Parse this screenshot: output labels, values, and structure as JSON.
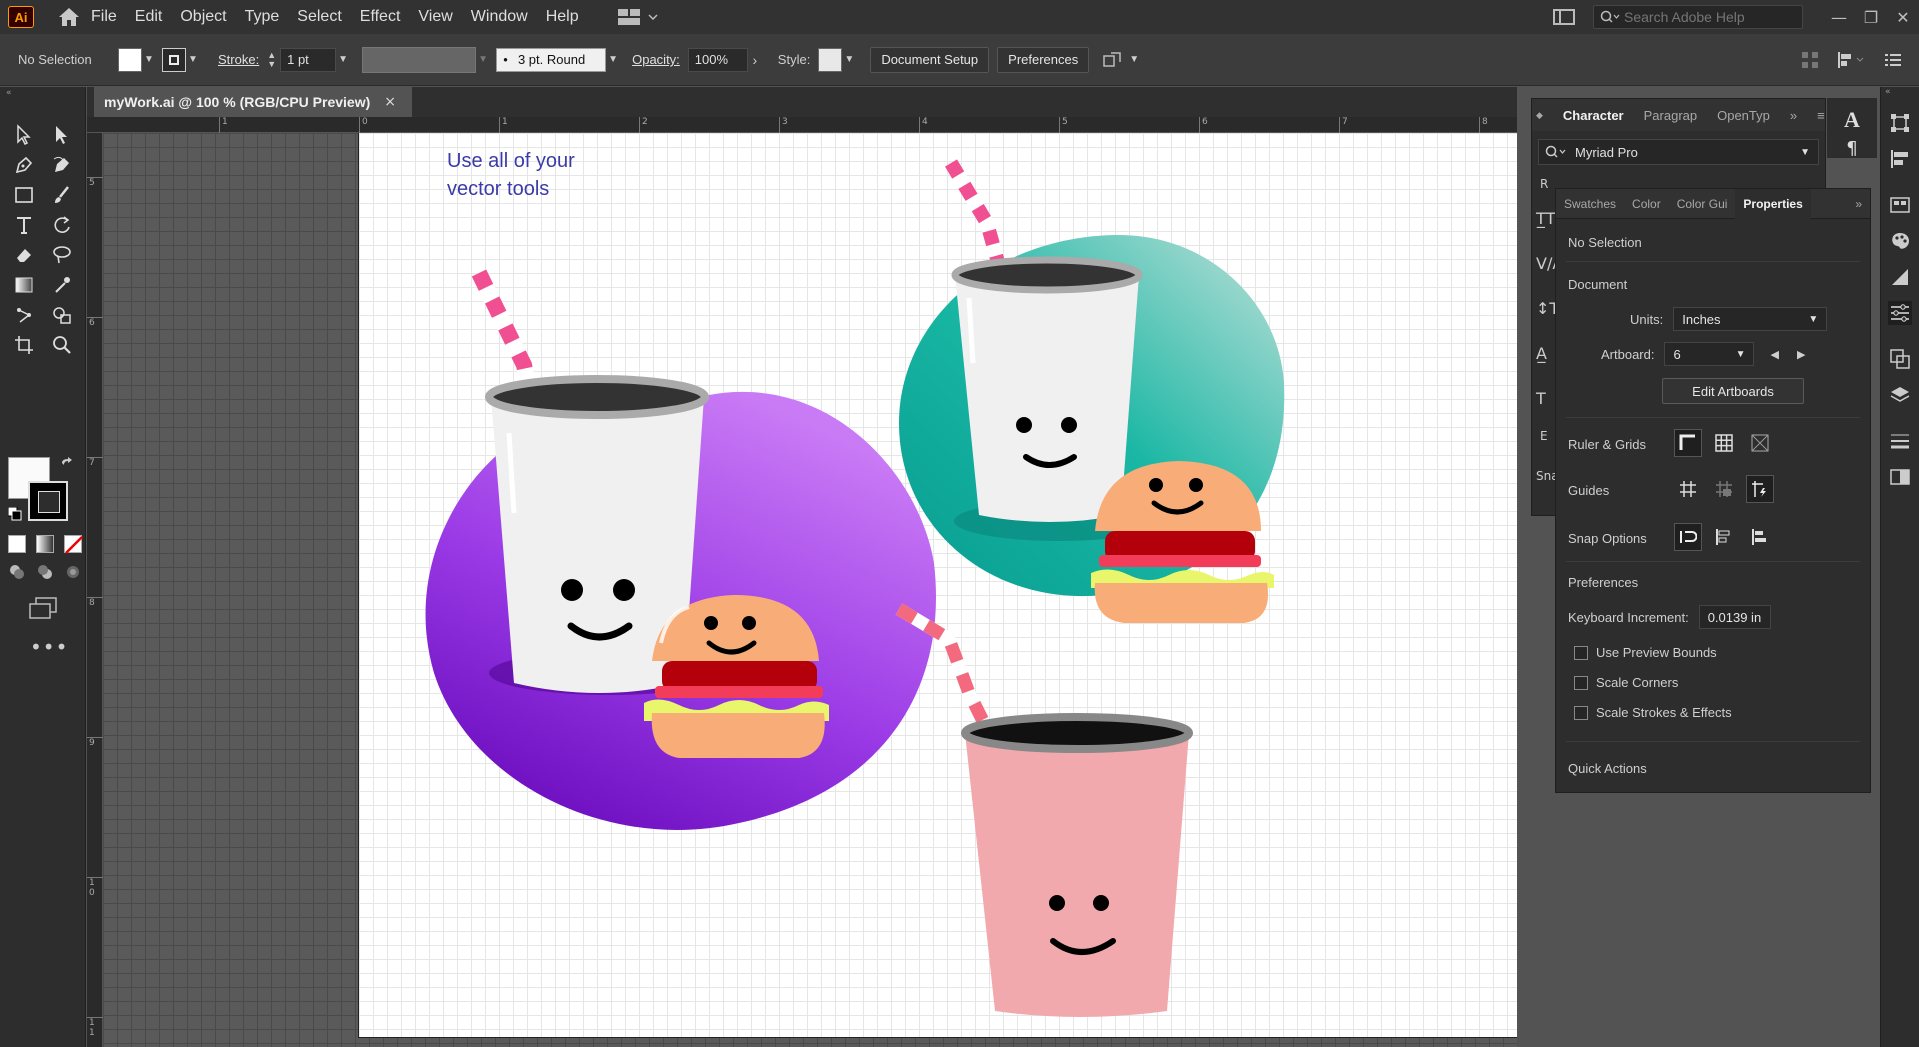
{
  "app": {
    "logo_text": "Ai"
  },
  "menu": {
    "items": [
      "File",
      "Edit",
      "Object",
      "Type",
      "Select",
      "Effect",
      "View",
      "Window",
      "Help"
    ]
  },
  "help_search": {
    "placeholder": "Search Adobe Help"
  },
  "control_bar": {
    "selection": "No Selection",
    "stroke_label": "Stroke:",
    "stroke_weight": "1 pt",
    "brush_profile": "3 pt. Round",
    "opacity_label": "Opacity:",
    "opacity_value": "100%",
    "style_label": "Style:",
    "document_setup": "Document Setup",
    "preferences": "Preferences"
  },
  "document": {
    "tab_title": "myWork.ai @ 100 % (RGB/CPU Preview)",
    "close": "×"
  },
  "ruler": {
    "h_marks": [
      "1",
      "0",
      "1",
      "2",
      "3",
      "4",
      "5",
      "6",
      "7",
      "8"
    ],
    "v_marks": [
      "5",
      "6",
      "7",
      "8",
      "9",
      "1\n0",
      "1\n1"
    ]
  },
  "artboard": {
    "heading": "Use all of your\nvector tools"
  },
  "character_panel": {
    "tabs": [
      "Character",
      "Paragrap",
      "OpenTyp"
    ],
    "font": "Myriad Pro",
    "peek_letters": [
      "R",
      "E",
      "Sna"
    ]
  },
  "properties_panel": {
    "tabs": [
      "Swatches",
      "Color",
      "Color Gui",
      "Properties"
    ],
    "active_tab": "Properties",
    "selection": "No Selection",
    "document_section": "Document",
    "units_label": "Units:",
    "units_value": "Inches",
    "artboard_label": "Artboard:",
    "artboard_value": "6",
    "edit_artboards": "Edit Artboards",
    "ruler_grids": "Ruler & Grids",
    "guides": "Guides",
    "snap_options": "Snap Options",
    "preferences_section": "Preferences",
    "keyboard_increment_label": "Keyboard Increment:",
    "keyboard_increment_value": "0.0139 in",
    "checkboxes": [
      "Use Preview Bounds",
      "Scale Corners",
      "Scale Strokes & Effects"
    ],
    "quick_actions": "Quick Actions"
  },
  "colors": {
    "purple_blob": "#8a22d6",
    "teal_blob": "#12b3a0",
    "cup_pink": "#f2a9ad",
    "bun": "#f8ad79",
    "patty": "#b3000a",
    "lettuce": "#e9f56b"
  }
}
